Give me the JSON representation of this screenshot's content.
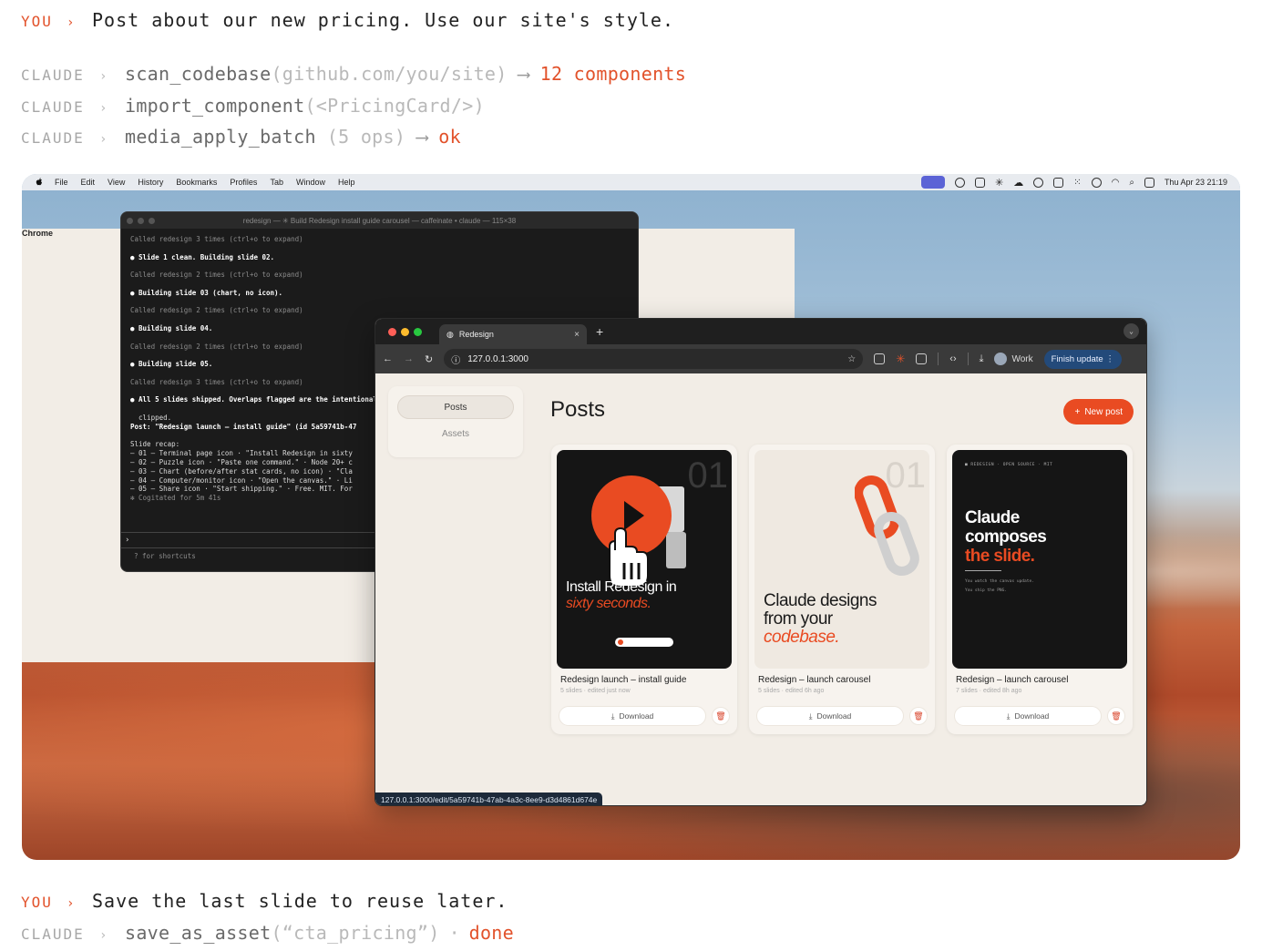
{
  "chat": {
    "line1": {
      "who": "YOU",
      "text": "Post about our new pricing. Use our site's style."
    },
    "line2": {
      "who": "CLAUDE",
      "fn": "scan_codebase",
      "arg": "(github.com/you/site)",
      "result": "12 components"
    },
    "line3": {
      "who": "CLAUDE",
      "fn": "import_component",
      "arg": "(<PricingCard/>)"
    },
    "line4": {
      "who": "CLAUDE",
      "fn": "media_apply_batch",
      "arg": "(5 ops)",
      "result": "ok"
    },
    "line5": {
      "who": "YOU",
      "text": "Save the last slide to reuse later."
    },
    "line6": {
      "who": "CLAUDE",
      "fn": "save_as_asset",
      "arg": "(“cta_pricing”)",
      "result": "done"
    }
  },
  "menubar": {
    "app": "Chrome",
    "items": [
      "File",
      "Edit",
      "View",
      "History",
      "Bookmarks",
      "Profiles",
      "Tab",
      "Window",
      "Help"
    ],
    "clock": "Thu Apr 23  21:19"
  },
  "terminal": {
    "title": "redesign — ✳ Build Redesign install guide carousel — caffeinate • claude — 115×38",
    "lines": [
      {
        "t": "Called redesign 3 times (ctrl+o to expand)",
        "s": "muted"
      },
      {
        "t": "● Slide 1 clean. Building slide 02.",
        "s": "b"
      },
      {
        "t": "Called redesign 2 times (ctrl+o to expand)",
        "s": "muted"
      },
      {
        "t": "● Building slide 03 (chart, no icon).",
        "s": "b"
      },
      {
        "t": "Called redesign 2 times (ctrl+o to expand)",
        "s": "muted"
      },
      {
        "t": "● Building slide 04.",
        "s": "b"
      },
      {
        "t": "Called redesign 2 times (ctrl+o to expand)",
        "s": "muted"
      },
      {
        "t": "● Building slide 05.",
        "s": "b"
      },
      {
        "t": "Called redesign 3 times (ctrl+o to expand)",
        "s": "muted"
      },
      {
        "t": "● All 5 slides shipped. Overlaps flagged are the intentional",
        "s": "b"
      },
      {
        "t": "  clipped.",
        "s": ""
      },
      {
        "t": "Post: \"Redesign launch — install guide\" (id 5a59741b-47",
        "s": "b"
      },
      {
        "t": "Slide recap:",
        "s": ""
      },
      {
        "t": "– 01 — Terminal page icon · \"Install Redesign in sixty",
        "s": ""
      },
      {
        "t": "– 02 — Puzzle icon · \"Paste one command.\" · Node 20+ c",
        "s": ""
      },
      {
        "t": "– 03 — Chart (before/after stat cards, no icon) · \"Cla",
        "s": ""
      },
      {
        "t": "– 04 — Computer/monitor icon · \"Open the canvas.\" · Li",
        "s": ""
      },
      {
        "t": "– 05 — Share icon · \"Start shipping.\" · Free. MIT. For",
        "s": ""
      },
      {
        "t": "✻ Cogitated for 5m 41s",
        "s": "muted"
      }
    ],
    "prompt": "›",
    "hint": "? for shortcuts"
  },
  "browser": {
    "tab_title": "Redesign",
    "url": "127.0.0.1:3000",
    "profile": "Work",
    "finish_update": "Finish update",
    "status_url": "127.0.0.1:3000/edit/5a59741b-47ab-4a3c-8ee9-d3d4861d674e"
  },
  "app": {
    "sidebar": [
      "Posts",
      "Assets"
    ],
    "title": "Posts",
    "new_post": "New post",
    "cards": [
      {
        "title": "Redesign launch – install guide",
        "sub": "5 slides · edited just now",
        "download": "Download",
        "slide_num": "01",
        "slide_text1": "Install Redesign in",
        "slide_text2": "sixty seconds."
      },
      {
        "title": "Redesign – launch carousel",
        "sub": "5 slides · edited 6h ago",
        "download": "Download",
        "slide_num": "01",
        "slide_text1": "Claude designs",
        "slide_text2": "from your",
        "slide_text3": "codebase."
      },
      {
        "title": "Redesign – launch carousel",
        "sub": "7 slides · edited 8h ago",
        "download": "Download",
        "slide_tag": "■ REDESIGN · OPEN SOURCE · MIT",
        "slide_text1": "Claude",
        "slide_text2": "composes",
        "slide_text3": "the slide.",
        "slide_small1": "You watch the canvas update.",
        "slide_small2": "You ship the PNG."
      }
    ]
  },
  "colors": {
    "accent": "#e2522b",
    "button": "#e94b22"
  }
}
